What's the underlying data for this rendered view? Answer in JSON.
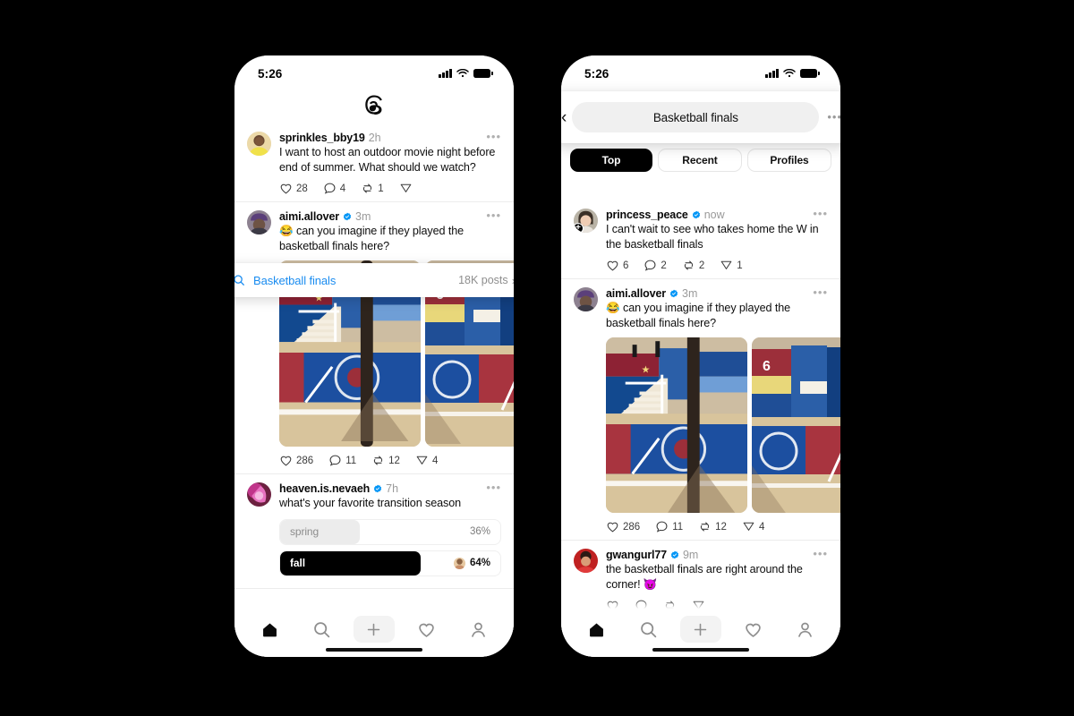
{
  "status_bar": {
    "time": "5:26",
    "signal_icon": "cellular-bars-icon",
    "wifi_icon": "wifi-icon",
    "battery_icon": "battery-full-icon"
  },
  "app": {
    "name": "Threads",
    "logo_icon": "threads-logo-icon"
  },
  "left_phone": {
    "search_pill": {
      "search_icon": "search-icon",
      "query": "Basketball finals",
      "count": "18K posts",
      "chevron": "›"
    },
    "posts": [
      {
        "username": "sprinkles_bby19",
        "verified": false,
        "timestamp": "2h",
        "text": "I want to host an outdoor movie night before end of summer. What should we watch?",
        "likes": "28",
        "replies": "4",
        "reposts": "1",
        "shares": ""
      },
      {
        "username": "aimi.allover",
        "verified": true,
        "timestamp": "3m",
        "emoji": "😂",
        "text": "can you imagine if they played the basketball finals here?",
        "likes": "286",
        "replies": "11",
        "reposts": "12",
        "shares": "4"
      },
      {
        "username": "heaven.is.nevaeh",
        "verified": true,
        "timestamp": "7h",
        "text": "what's your favorite transition season",
        "poll": [
          {
            "label": "spring",
            "percent": "36%",
            "fill": 36,
            "selected": false
          },
          {
            "label": "fall",
            "percent": "64%",
            "fill": 64,
            "selected": true
          }
        ]
      }
    ]
  },
  "right_phone": {
    "header": {
      "back_icon": "back-chevron-icon",
      "query": "Basketball finals",
      "more_icon": "more-options-icon"
    },
    "tabs": [
      {
        "label": "Top",
        "active": true
      },
      {
        "label": "Recent",
        "active": false
      },
      {
        "label": "Profiles",
        "active": false
      }
    ],
    "posts": [
      {
        "username": "princess_peace",
        "verified": true,
        "timestamp": "now",
        "follow_badge": "add-follow-icon",
        "text": "I can't wait to see who takes home the W in the basketball finals",
        "likes": "6",
        "replies": "2",
        "reposts": "2",
        "shares": "1"
      },
      {
        "username": "aimi.allover",
        "verified": true,
        "timestamp": "3m",
        "emoji": "😂",
        "text": "can you imagine if they played the basketball finals here?",
        "likes": "286",
        "replies": "11",
        "reposts": "12",
        "shares": "4"
      },
      {
        "username": "gwangurl77",
        "verified": true,
        "timestamp": "9m",
        "text": "the basketball finals are right around the corner!",
        "trailing_emoji": "😈"
      }
    ]
  },
  "bottom_nav": [
    {
      "icon": "home-icon",
      "active": true
    },
    {
      "icon": "search-icon",
      "active": false
    },
    {
      "icon": "create-post-plus-icon",
      "active": false
    },
    {
      "icon": "activity-heart-icon",
      "active": false
    },
    {
      "icon": "profile-person-icon",
      "active": false
    }
  ],
  "colors": {
    "accent_blue": "#1a8cf0",
    "verified_blue": "#0095f6",
    "active_black": "#000000",
    "muted_gray": "#9a9a9a"
  }
}
